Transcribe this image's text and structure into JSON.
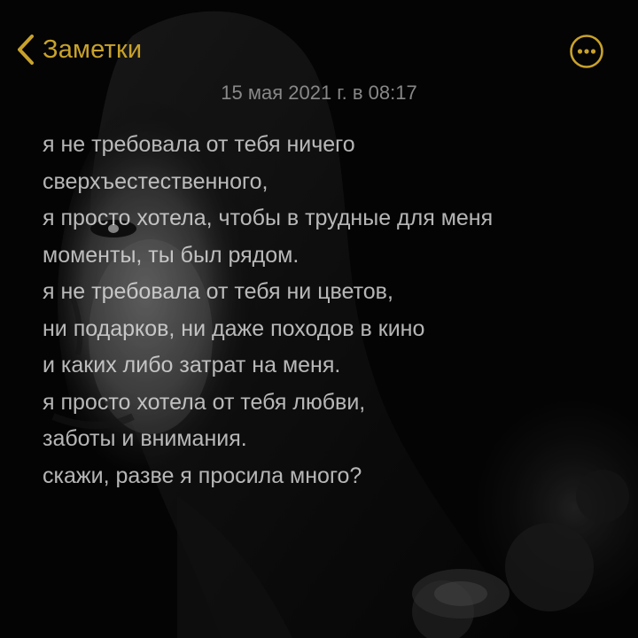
{
  "navigation": {
    "back_label": "Заметки",
    "back_icon": "chevron-left-icon",
    "more_icon": "ellipsis-circle-icon"
  },
  "note": {
    "date": "15 мая 2021 г. в 08:17",
    "lines": [
      "я не требовала от тебя ничего",
      "сверхъестественного,",
      "я просто хотела, чтобы в трудные для меня",
      "моменты, ты был рядом.",
      "я не требовала от тебя ни цветов,",
      "ни подарков, ни даже походов в кино",
      "и каких либо затрат на меня.",
      "я просто хотела от тебя любви,",
      "заботы и внимания.",
      "скажи, разве я просила много?"
    ]
  },
  "colors": {
    "accent": "#c9a22b",
    "background": "#050505",
    "text": "#e8e8e8",
    "date_text": "#969696"
  }
}
